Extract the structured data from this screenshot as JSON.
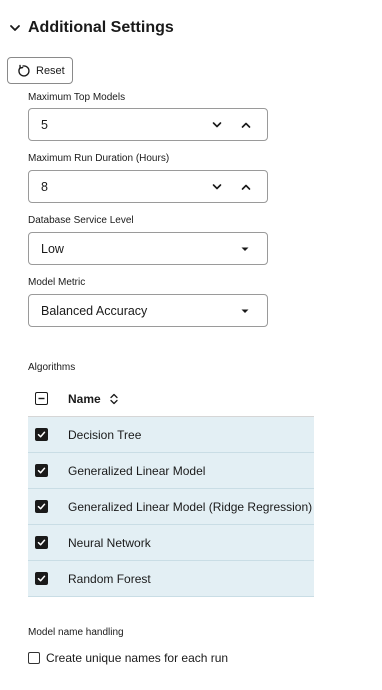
{
  "section": {
    "title": "Additional Settings",
    "expanded": true
  },
  "reset_button": {
    "label": "Reset"
  },
  "fields": {
    "max_top_models": {
      "label": "Maximum Top Models",
      "value": "5"
    },
    "max_run_duration": {
      "label": "Maximum Run Duration (Hours)",
      "value": "8"
    },
    "db_service_level": {
      "label": "Database Service Level",
      "value": "Low"
    },
    "model_metric": {
      "label": "Model Metric",
      "value": "Balanced Accuracy"
    }
  },
  "algorithms": {
    "label": "Algorithms",
    "column_header": "Name",
    "select_all_state": "partial",
    "rows": [
      {
        "name": "Decision Tree",
        "checked": true
      },
      {
        "name": "Generalized Linear Model",
        "checked": true
      },
      {
        "name": "Generalized Linear Model (Ridge Regression)",
        "checked": true
      },
      {
        "name": "Neural Network",
        "checked": true
      },
      {
        "name": "Random Forest",
        "checked": true
      }
    ]
  },
  "model_name_handling": {
    "label": "Model name handling",
    "option_label": "Create unique names for each run",
    "checked": false
  },
  "colors": {
    "row_selected_bg": "#e3eff4",
    "text": "#1a1a1a",
    "border": "#9a9a9a"
  }
}
